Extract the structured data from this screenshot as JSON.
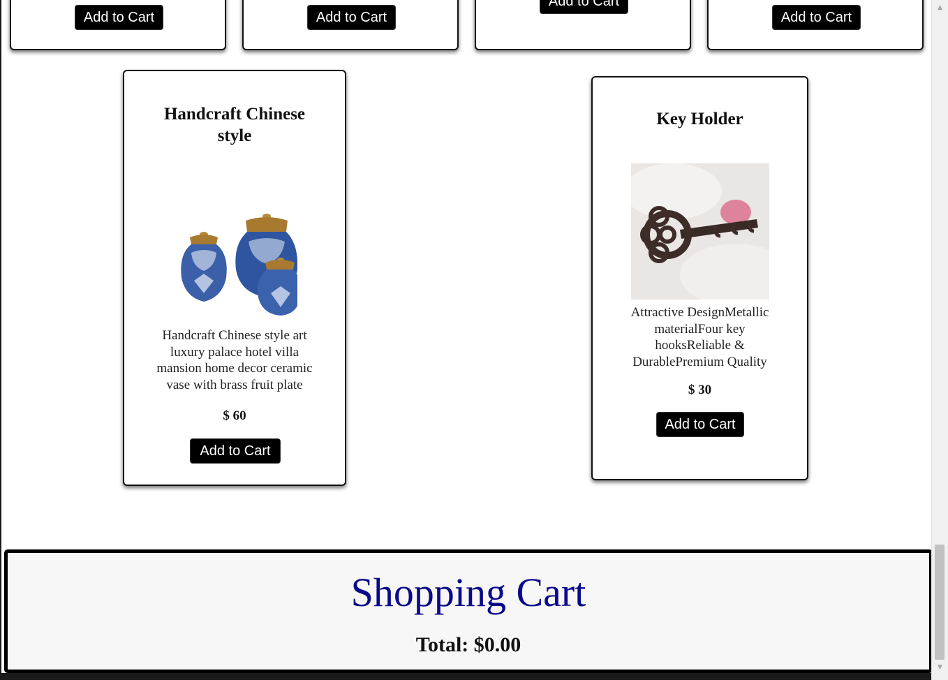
{
  "top_row": {
    "buttons": [
      {
        "label": "Add to Cart"
      },
      {
        "label": "Add to Cart"
      },
      {
        "label": "Add to Cart"
      },
      {
        "label": "Add to Cart"
      }
    ]
  },
  "products": [
    {
      "title": "Handcraft Chinese style",
      "description": "Handcraft Chinese style art luxury palace hotel villa mansion home decor ceramic vase with brass fruit plate",
      "price": "$ 60",
      "button": "Add to Cart",
      "image": "ceramic-vases-image"
    },
    {
      "title": "Key Holder",
      "description": "Attractive DesignMetallic materialFour key hooksReliable & DurablePremium Quality",
      "price": "$ 30",
      "button": "Add to Cart",
      "image": "key-holder-image"
    }
  ],
  "cart": {
    "title": "Shopping Cart",
    "total": "Total: $0.00"
  },
  "colors": {
    "button_bg": "#000000",
    "cart_title": "#0a0a8a",
    "cart_bg": "#f7f7f7"
  },
  "icons": [
    "scroll-up-arrow-icon",
    "scroll-down-arrow-icon"
  ]
}
